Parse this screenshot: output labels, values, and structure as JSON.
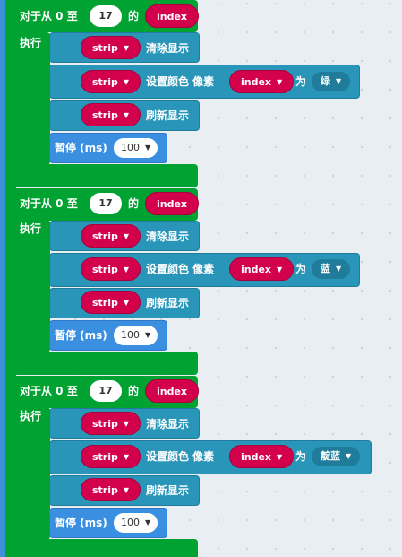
{
  "loop": {
    "header_prefix": "对于从 0 至",
    "header_of": "的",
    "body_label": "执行",
    "end_value": "17",
    "var_name": "index"
  },
  "blocks": {
    "strip_var": "strip",
    "clear_label": "清除显示",
    "set_color_label": "设置颜色 像素",
    "index_var": "index",
    "as_label": "为",
    "show_label": "刷新显示",
    "pause_label": "暂停 (ms)",
    "pause_value": "100"
  },
  "loops": [
    {
      "color": "绿"
    },
    {
      "color": "蓝"
    },
    {
      "color": "靛蓝"
    }
  ],
  "icons": {
    "dropdown": "caret-down-icon"
  },
  "colors": {
    "loop_green": "#00a331",
    "neopixel_teal": "#2995b8",
    "variable_red": "#d3004c",
    "basic_blue": "#3b8fe0",
    "workspace": "#e9eef2"
  }
}
